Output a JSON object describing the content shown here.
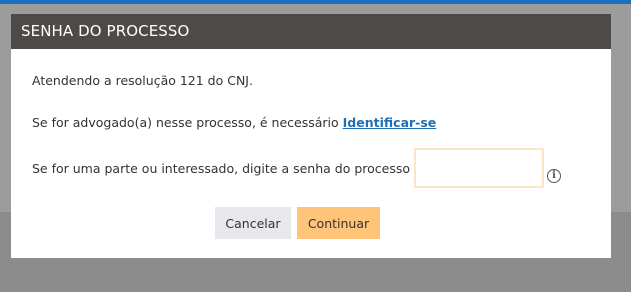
{
  "dialog": {
    "title": "SENHA DO PROCESSO",
    "line1": "Atendendo a resolução 121 do CNJ.",
    "line2_prefix": "Se for advogado(a) nesse processo, é necessário ",
    "line2_link": "Identificar-se",
    "line3": "Se for uma parte ou interessado, digite a senha do processo",
    "password_value": "",
    "buttons": {
      "cancel": "Cancelar",
      "continue": "Continuar"
    }
  },
  "colors": {
    "header_bg": "#4e4a47",
    "link": "#1f6fb2",
    "continue_bg": "#ffc37a",
    "cancel_bg": "#e8e8ec",
    "input_border": "#fbe4c8",
    "top_bar": "#1b6fc0"
  },
  "icons": {
    "info": "info-icon"
  }
}
